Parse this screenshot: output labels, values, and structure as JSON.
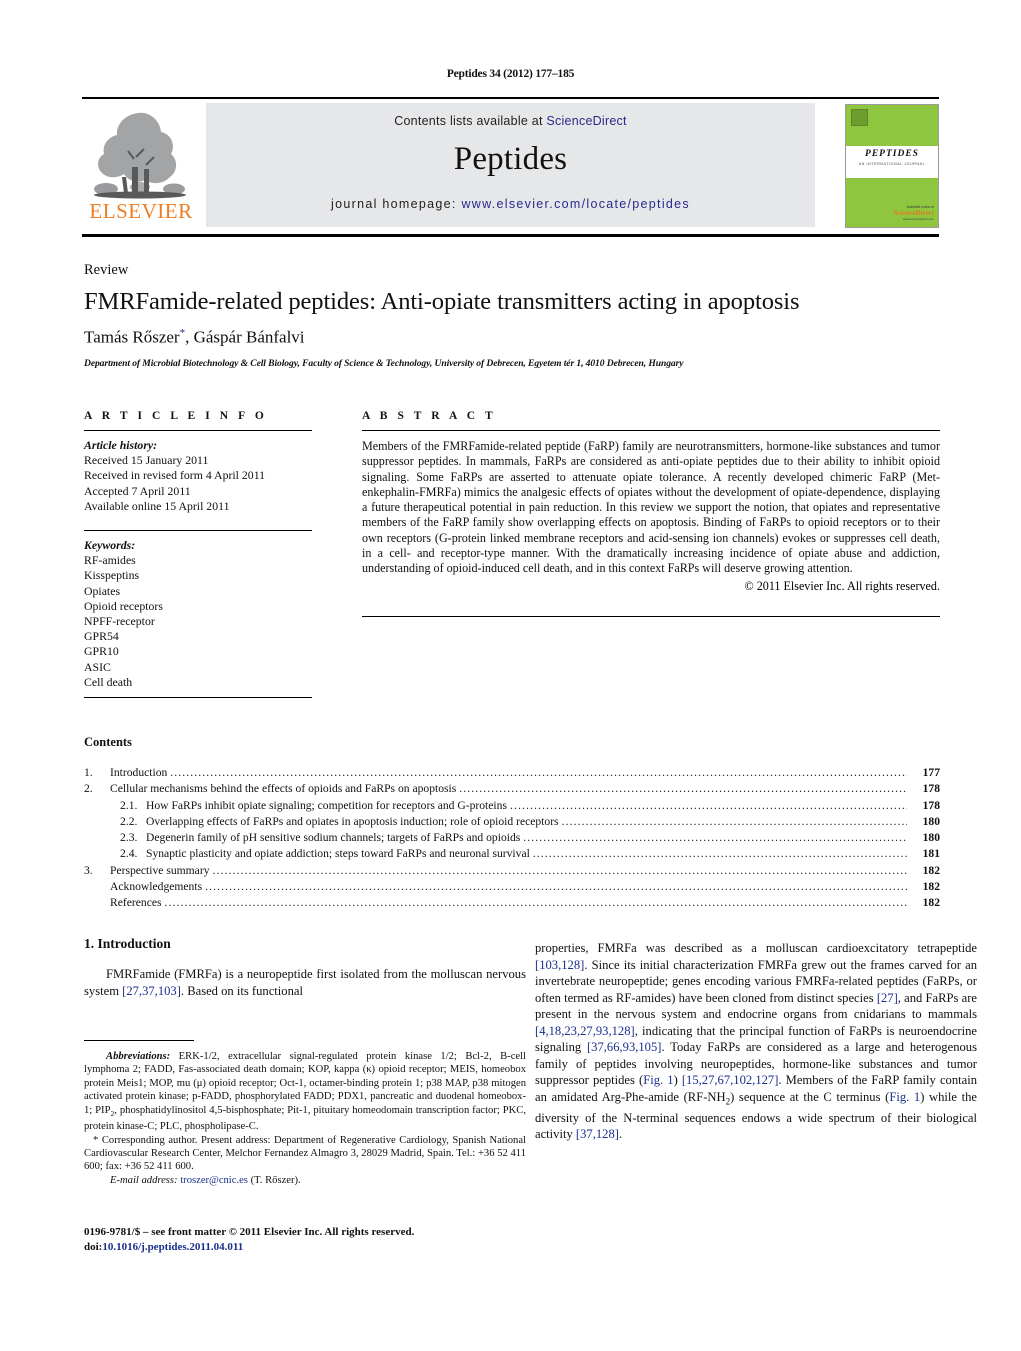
{
  "running_head": "Peptides 34 (2012) 177–185",
  "masthead": {
    "publisher_name": "ELSEVIER",
    "contents_line_prefix": "Contents lists available at ",
    "contents_line_link": "ScienceDirect",
    "journal_title": "Peptides",
    "homepage_prefix": "journal homepage: ",
    "homepage_url": "www.elsevier.com/locate/peptides",
    "cover": {
      "title": "PEPTIDES",
      "subtitle": "AN INTERNATIONAL JOURNAL",
      "sd_line1": "Available online at",
      "sd_line2": "ScienceDirect",
      "sd_line3": "www.sciencedirect.com"
    },
    "accent_green": "#8ec63f",
    "accent_orange": "#ef7d20",
    "link_blue": "#2a2a8c"
  },
  "article": {
    "doctype": "Review",
    "title": "FMRFamide-related peptides: Anti-opiate transmitters acting in apoptosis",
    "authors_part1": "Tamás Rőszer",
    "authors_star": "*",
    "authors_part2": ", Gáspár Bánfalvi",
    "affiliation": "Department of Microbial Biotechnology & Cell Biology, Faculty of Science & Technology, University of Debrecen, Egyetem tér 1, 4010 Debrecen, Hungary"
  },
  "article_info": {
    "heading": "A R T I C L E    I N F O",
    "history_label": "Article history:",
    "history": [
      "Received 15 January 2011",
      "Received in revised form 4 April 2011",
      "Accepted 7 April 2011",
      "Available online 15 April 2011"
    ],
    "keywords_label": "Keywords:",
    "keywords": [
      "RF-amides",
      "Kisspeptins",
      "Opiates",
      "Opioid receptors",
      "NPFF-receptor",
      "GPR54",
      "GPR10",
      "ASIC",
      "Cell death"
    ]
  },
  "abstract": {
    "heading": "A B S T R A C T",
    "body": "Members of the FMRFamide-related peptide (FaRP) family are neurotransmitters, hormone-like substances and tumor suppressor peptides. In mammals, FaRPs are considered as anti-opiate peptides due to their ability to inhibit opioid signaling. Some FaRPs are asserted to attenuate opiate tolerance. A recently developed chimeric FaRP (Met-enkephalin-FMRFa) mimics the analgesic effects of opiates without the development of opiate-dependence, displaying a future therapeutical potential in pain reduction. In this review we support the notion, that opiates and representative members of the FaRP family show overlapping effects on apoptosis. Binding of FaRPs to opioid receptors or to their own receptors (G-protein linked membrane receptors and acid-sensing ion channels) evokes or suppresses cell death, in a cell- and receptor-type manner. With the dramatically increasing incidence of opiate abuse and addiction, understanding of opioid-induced cell death, and in this context FaRPs will deserve growing attention.",
    "copyright": "© 2011 Elsevier Inc. All rights reserved."
  },
  "contents": {
    "heading": "Contents",
    "items": [
      {
        "num": "1.",
        "level": 1,
        "label": "Introduction",
        "page": "177"
      },
      {
        "num": "2.",
        "level": 1,
        "label": "Cellular mechanisms behind the effects of opioids and FaRPs on apoptosis",
        "page": "178"
      },
      {
        "num": "2.1.",
        "level": 2,
        "label": "How FaRPs inhibit opiate signaling; competition for receptors and G-proteins",
        "page": "178"
      },
      {
        "num": "2.2.",
        "level": 2,
        "label": "Overlapping effects of FaRPs and opiates in apoptosis induction; role of opioid receptors",
        "page": "180"
      },
      {
        "num": "2.3.",
        "level": 2,
        "label": "Degenerin family of pH sensitive sodium channels; targets of FaRPs and opioids",
        "page": "180"
      },
      {
        "num": "2.4.",
        "level": 2,
        "label": "Synaptic plasticity and opiate addiction; steps toward FaRPs and neuronal survival",
        "page": "181"
      },
      {
        "num": "3.",
        "level": 1,
        "label": "Perspective summary",
        "page": "182"
      },
      {
        "num": "",
        "level": 1,
        "label": "Acknowledgements",
        "page": "182"
      },
      {
        "num": "",
        "level": 1,
        "label": "References",
        "page": "182"
      }
    ]
  },
  "introduction": {
    "heading": "1.  Introduction",
    "left_para_a": "FMRFamide (FMRFa) is a neuropeptide first isolated from the molluscan nervous system ",
    "left_ref_1": "[27,37,103]",
    "left_para_b": ". Based on its functional",
    "right_para_1a": "properties, FMRFa was described as a molluscan cardioexcitatory tetrapeptide ",
    "right_ref_1": "[103,128]",
    "right_para_1b": ". Since its initial characterization FMRFa grew out the frames carved for an invertebrate neuropeptide; genes encoding various FMRFa-related peptides (FaRPs, or often termed as RF-amides) have been cloned from distinct species ",
    "right_ref_2": "[27]",
    "right_para_1c": ", and FaRPs are present in the nervous system and endocrine organs from cnidarians to mammals ",
    "right_ref_3": "[4,18,23,27,93,128]",
    "right_para_1d": ", indicating that the principal function of FaRPs is neuroendocrine signaling ",
    "right_ref_4": "[37,66,93,105]",
    "right_para_1e": ". Today FaRPs are considered as a large and heterogenous family of peptides involving neuropeptides, hormone-like substances and tumor suppressor peptides (",
    "right_ref_5": "Fig. 1",
    "right_para_1f": ") ",
    "right_ref_6": "[15,27,67,102,127]",
    "right_para_1g": ". Members of the FaRP family contain an amidated Arg-Phe-amide (RF-NH",
    "right_sub_2": "2",
    "right_para_1h": ") sequence at the C terminus (",
    "right_ref_7": "Fig. 1",
    "right_para_1i": ") while the diversity of the N-terminal sequences endows a wide spectrum of their biological activity ",
    "right_ref_8": "[37,128]",
    "right_para_1j": "."
  },
  "footnotes": {
    "abbrev_label": "Abbreviations:",
    "abbrev_body": " ERK-1/2, extracellular signal-regulated protein kinase 1/2; Bcl-2, B-cell lymphoma 2; FADD, Fas-associated death domain; KOP, kappa (κ) opioid receptor; MEIS, homeobox protein Meis1; MOP, mu (μ) opioid receptor; Oct-1, octamer-binding protein 1; p38 MAP, p38 mitogen activated protein kinase; p-FADD, phosphorylated FADD; PDX1, pancreatic and duodenal homeobox-1; PIP",
    "abbrev_sub": "2",
    "abbrev_body2": ", phosphatidylinositol 4,5-bisphosphate; Pit-1, pituitary homeodomain transcription factor; PKC, protein kinase-C; PLC, phospholipase-C.",
    "corresponding": "* Corresponding author. Present address: Department of Regenerative Cardiology, Spanish National Cardiovascular Research Center, Melchor Fernandez Almagro 3, 28029 Madrid, Spain. Tel.: +36 52 411 600; fax: +36 52 411 600.",
    "email_label": "E-mail address:",
    "email_link": "troszer@cnic.es",
    "email_suffix": " (T. Rőszer)."
  },
  "footer": {
    "line1": "0196-9781/$ – see front matter © 2011 Elsevier Inc. All rights reserved.",
    "doi_label": "doi:",
    "doi_value": "10.1016/j.peptides.2011.04.011"
  }
}
